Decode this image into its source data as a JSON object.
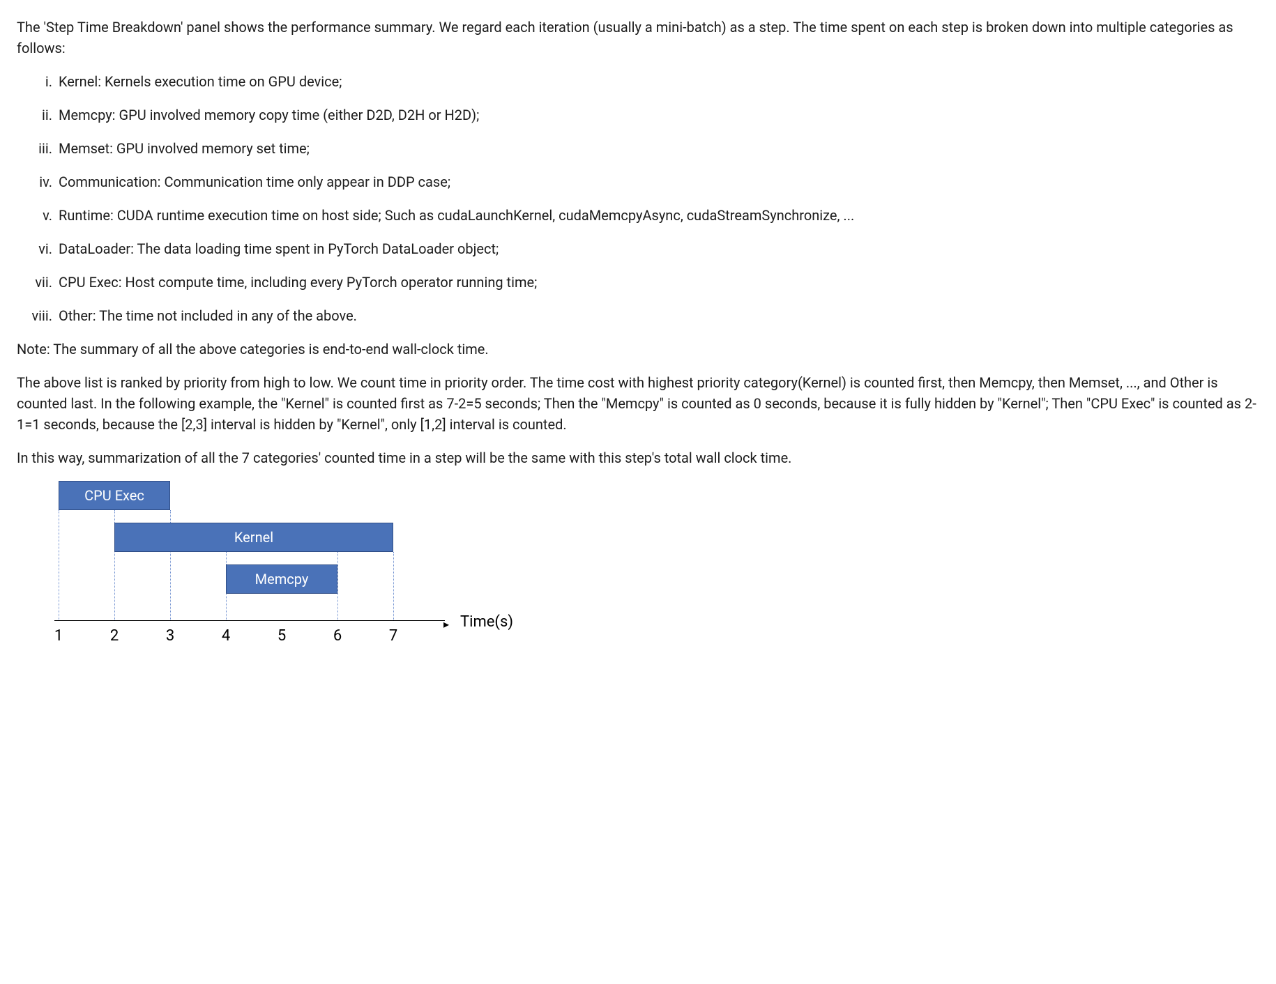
{
  "intro": "The 'Step Time Breakdown' panel shows the performance summary. We regard each iteration (usually a mini-batch) as a step. The time spent on each step is broken down into multiple categories as follows:",
  "items": [
    "Kernel: Kernels execution time on GPU device;",
    "Memcpy: GPU involved memory copy time (either D2D, D2H or H2D);",
    "Memset: GPU involved memory set time;",
    "Communication: Communication time only appear in DDP case;",
    "Runtime: CUDA runtime execution time on host side; Such as cudaLaunchKernel, cudaMemcpyAsync, cudaStreamSynchronize, ...",
    "DataLoader: The data loading time spent in PyTorch DataLoader object;",
    "CPU Exec: Host compute time, including every PyTorch operator running time;",
    "Other: The time not included in any of the above."
  ],
  "note": "Note: The summary of all the above categories is end-to-end wall-clock time.",
  "para2": "The above list is ranked by priority from high to low. We count time in priority order. The time cost with highest priority category(Kernel) is counted first, then Memcpy, then Memset, ..., and Other is counted last. In the following example, the \"Kernel\" is counted first as 7-2=5 seconds; Then the \"Memcpy\" is counted as 0 seconds, because it is fully hidden by \"Kernel\"; Then \"CPU Exec\" is counted as 2-1=1 seconds, because the [2,3] interval is hidden by \"Kernel\", only [1,2] interval is counted.",
  "para3": "In this way, summarization of all the 7 categories' counted time in a step will be the same with this step's total wall clock time.",
  "chart_data": {
    "type": "gantt",
    "xlabel": "Time(s)",
    "xlim": [
      1,
      7
    ],
    "ticks": [
      1,
      2,
      3,
      4,
      5,
      6,
      7
    ],
    "bars": [
      {
        "name": "CPU Exec",
        "start": 1,
        "end": 3
      },
      {
        "name": "Kernel",
        "start": 2,
        "end": 7
      },
      {
        "name": "Memcpy",
        "start": 4,
        "end": 6
      }
    ]
  }
}
